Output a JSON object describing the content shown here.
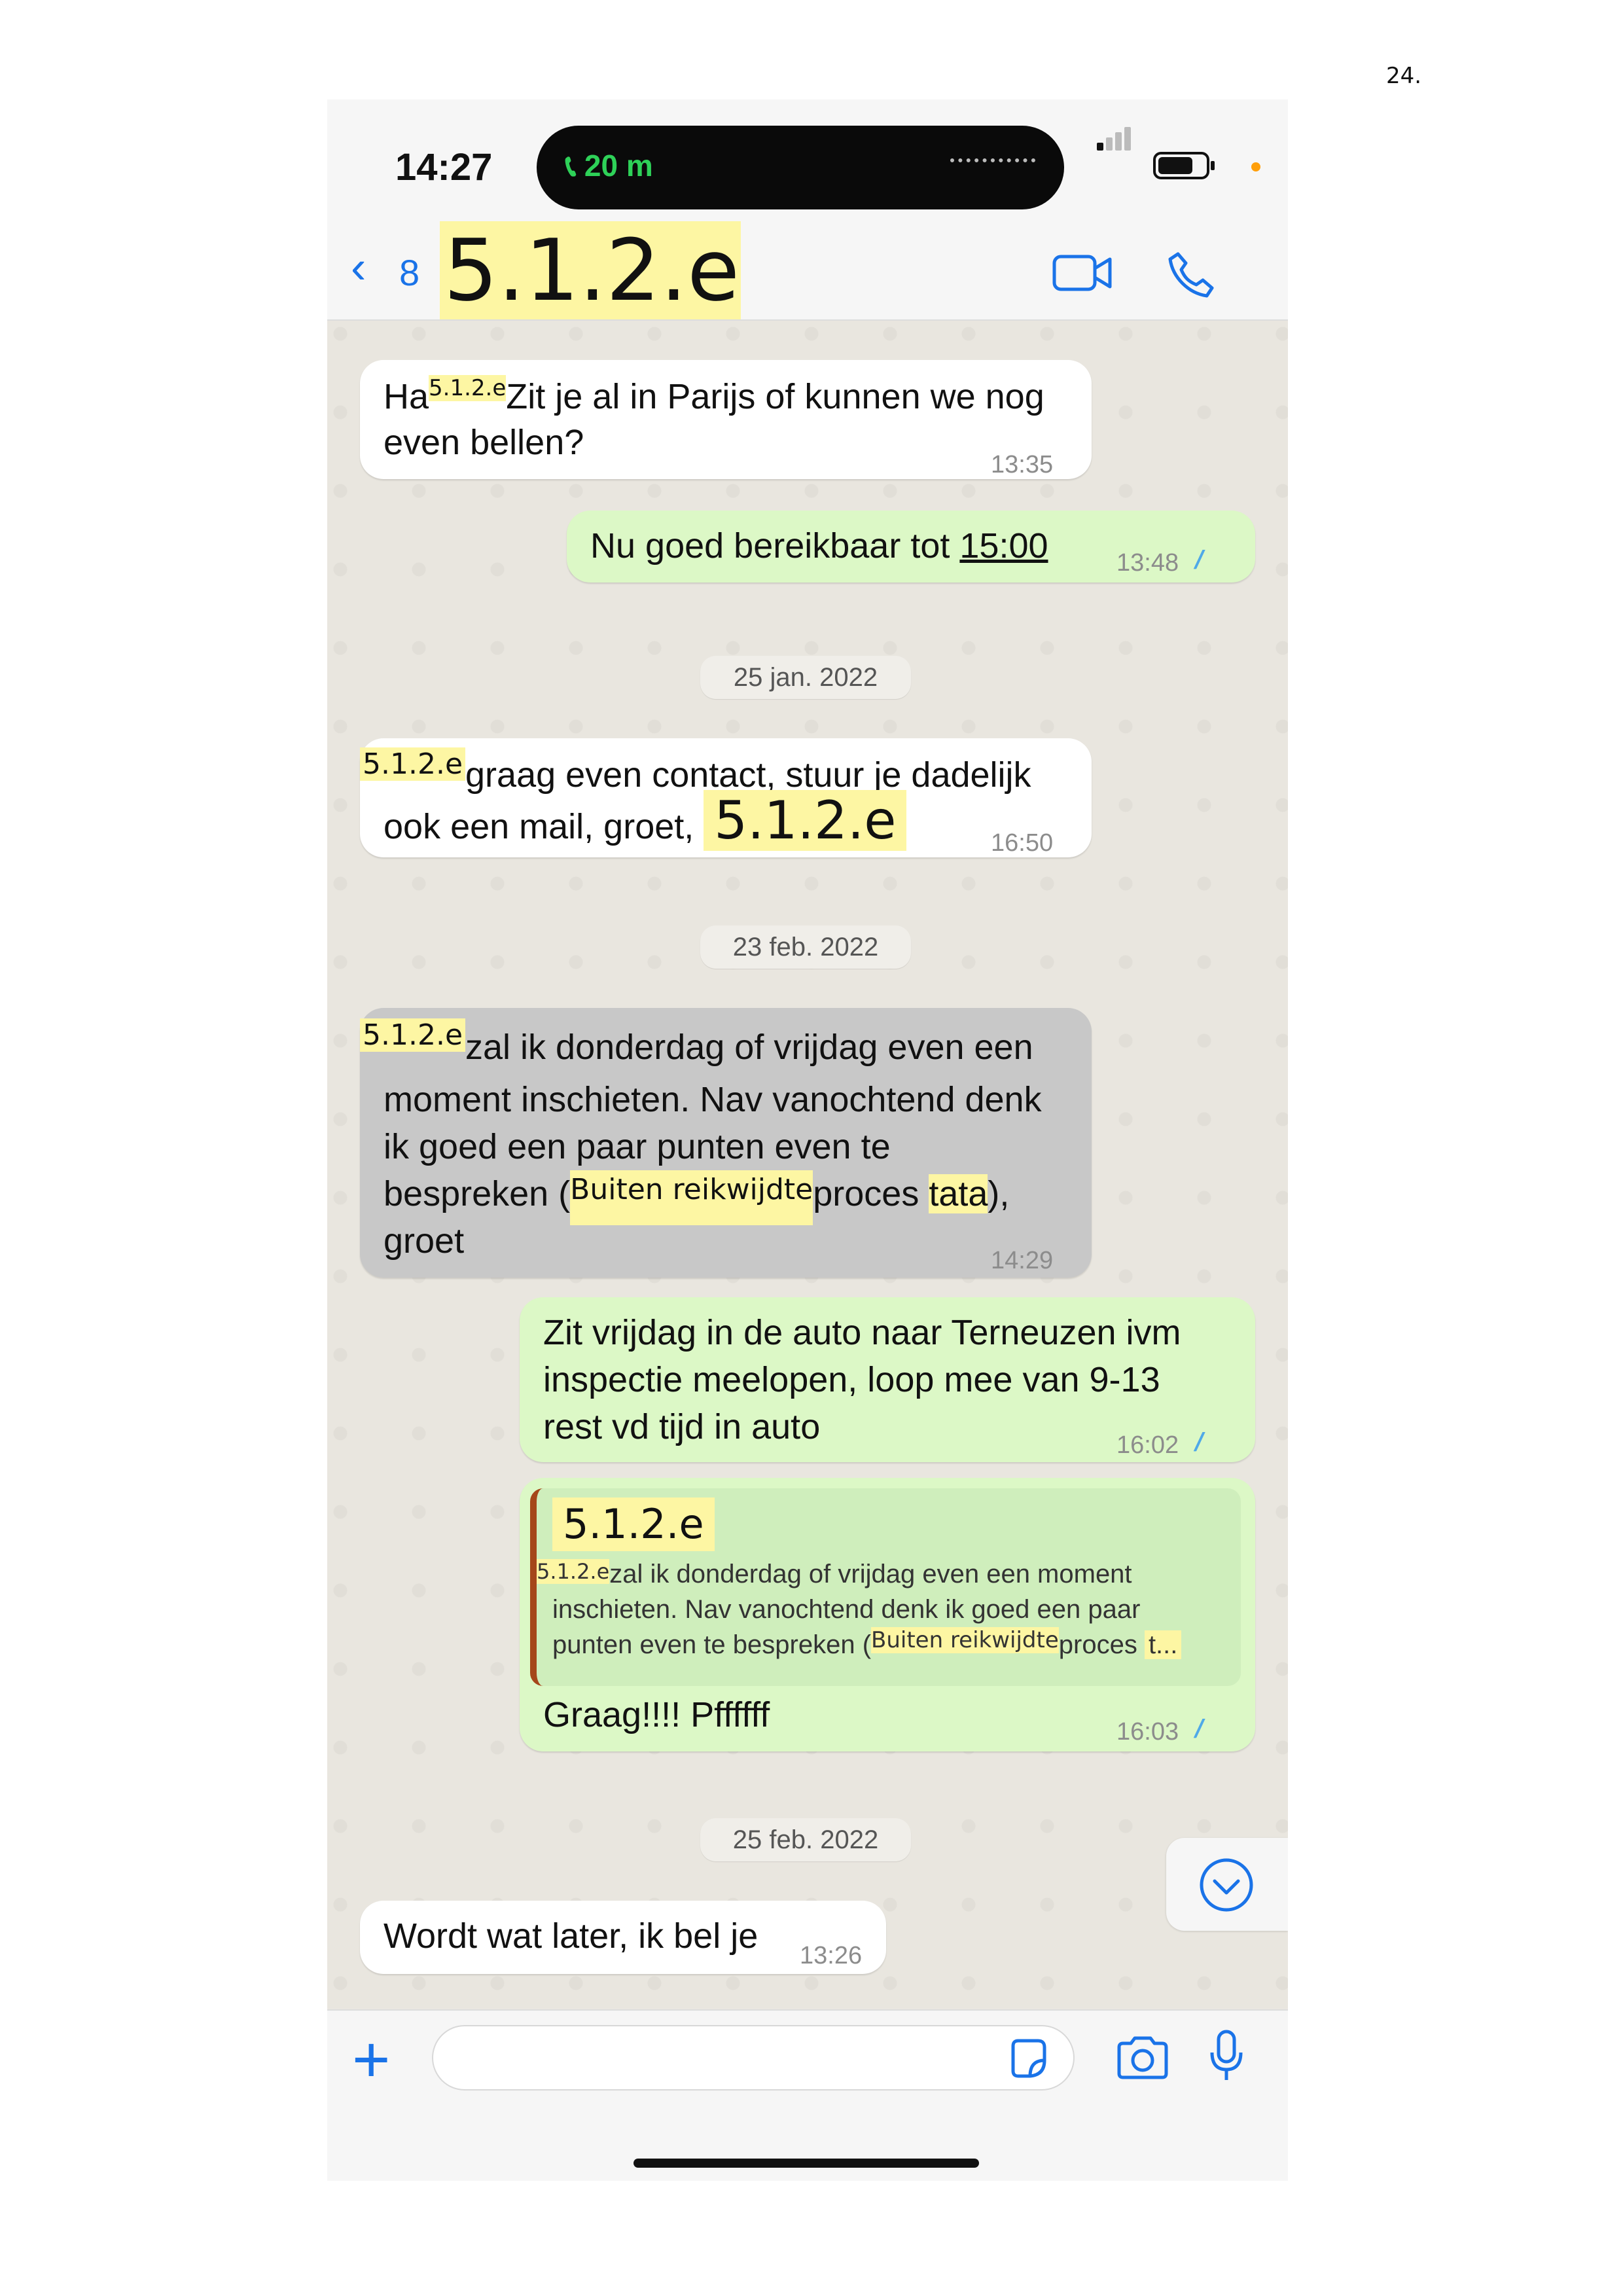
{
  "page_number": "24.",
  "status_bar": {
    "time": "14:27",
    "call_indicator": "20 m",
    "icons": [
      "phone-icon",
      "signal-icon",
      "battery-icon"
    ]
  },
  "header": {
    "back_count": "8",
    "contact_name": "5.1.2.e",
    "icons": [
      "chevron-left-icon",
      "video-call-icon",
      "phone-call-icon"
    ]
  },
  "messages": [
    {
      "dir": "in",
      "parts": [
        "Ha",
        "5.1.2.e",
        "Zit je al in Parijs of kunnen we nog",
        "even bellen?"
      ],
      "time": "13:35"
    },
    {
      "dir": "out",
      "text_before": "Nu goed bereikbaar tot ",
      "link": "15:00",
      "time": "13:48"
    },
    {
      "date": "25 jan. 2022"
    },
    {
      "dir": "in",
      "parts": [
        "5.1.2.e",
        "graag even contact, stuur je dadelijk",
        "ook een mail, groet, ",
        "5.1.2.e"
      ],
      "time": "16:50"
    },
    {
      "date": "23 feb. 2022"
    },
    {
      "dir": "in-selected",
      "parts": [
        "5.1.2.e",
        "zal ik donderdag of vrijdag even een",
        "moment inschieten. Nav vanochtend denk",
        "ik goed een paar punten even te",
        "bespreken (",
        "Buiten reikwijdte",
        "proces ",
        "tata",
        "),",
        "groet"
      ],
      "time": "14:29"
    },
    {
      "dir": "out",
      "lines": [
        "Zit vrijdag in de auto naar Terneuzen ivm",
        "inspectie meelopen, loop mee van 9-13",
        "rest vd tijd in auto"
      ],
      "time": "16:02"
    },
    {
      "dir": "out",
      "quote": {
        "author": "5.1.2.e",
        "parts": [
          "5.1.2.e",
          "zal ik donderdag of vrijdag even een moment",
          "inschieten. Nav vanochtend denk ik goed een paar",
          "punten even te bespreken (",
          "Buiten reikwijdte",
          "proces ",
          "t..."
        ]
      },
      "text": "Graag!!!! Pffffff",
      "time": "16:03"
    },
    {
      "date": "25 feb. 2022"
    },
    {
      "dir": "in",
      "text": "Wordt wat later, ik bel je",
      "time": "13:26"
    }
  ],
  "input_bar": {
    "icons": [
      "plus-icon",
      "sticker-icon",
      "camera-icon",
      "microphone-icon"
    ]
  },
  "colors": {
    "incoming": "#ffffff",
    "outgoing": "#dcf8c6",
    "selected": "#c8c8c8",
    "accent": "#1a73e8",
    "redaction": "#fdf6a3",
    "read_ticks": "#4fa9e8"
  }
}
